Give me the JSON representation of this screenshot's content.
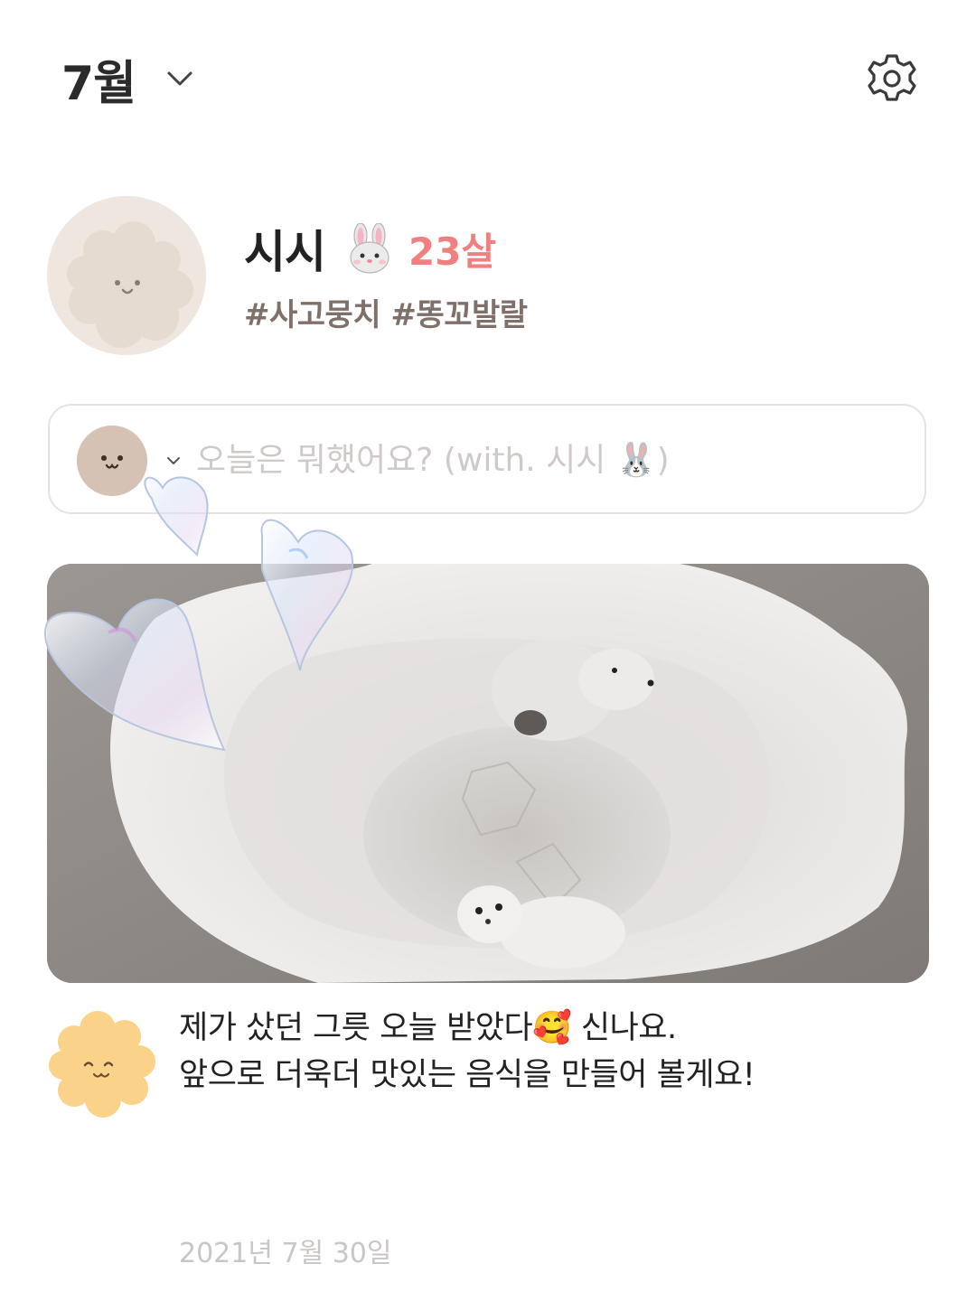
{
  "header": {
    "month_label": "7월",
    "settings_icon": "gear-icon",
    "month_dropdown_icon": "chevron-down-icon"
  },
  "profile": {
    "name": "시시",
    "name_emoji": "rabbit-face-icon",
    "age": "23살",
    "tags": "#사고뭉치 #똥꼬발랄",
    "age_color": "#f07f7f"
  },
  "composer": {
    "placeholder": "오늘은 뭐했어요? (with. 시시 🐰)"
  },
  "post": {
    "line1": "제가 샀던 그릇 오늘 받았다🥰 신나요.",
    "line2": "앞으로 더욱더 맛있는 음식을 만들어 볼게요!",
    "date": "2021년 7월 30일"
  }
}
